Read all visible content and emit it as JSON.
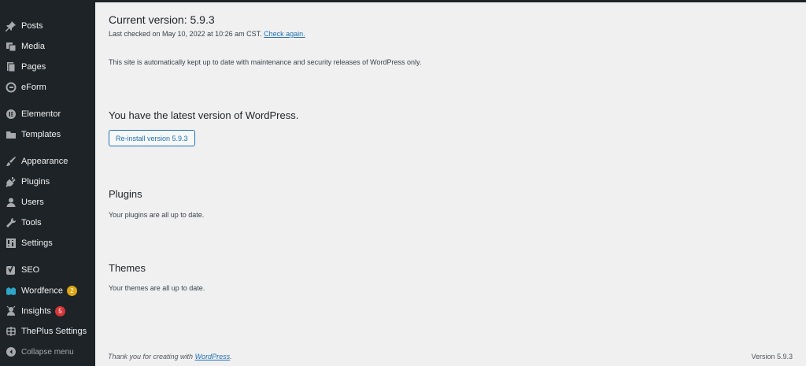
{
  "sidebar": {
    "items": [
      {
        "label": "Posts",
        "icon": "pin-icon"
      },
      {
        "label": "Media",
        "icon": "media-icon"
      },
      {
        "label": "Pages",
        "icon": "pages-icon"
      },
      {
        "label": "eForm",
        "icon": "eform-icon"
      },
      {
        "label": "Elementor",
        "icon": "elementor-icon"
      },
      {
        "label": "Templates",
        "icon": "folder-icon"
      },
      {
        "label": "Appearance",
        "icon": "brush-icon"
      },
      {
        "label": "Plugins",
        "icon": "plug-icon"
      },
      {
        "label": "Users",
        "icon": "user-icon"
      },
      {
        "label": "Tools",
        "icon": "wrench-icon"
      },
      {
        "label": "Settings",
        "icon": "settings-icon"
      },
      {
        "label": "SEO",
        "icon": "yoast-icon"
      },
      {
        "label": "Wordfence",
        "icon": "wordfence-icon",
        "badge": "2"
      },
      {
        "label": "Insights",
        "icon": "insights-icon",
        "badge": "5"
      },
      {
        "label": "ThePlus Settings",
        "icon": "theplus-icon"
      }
    ],
    "collapse_label": "Collapse menu"
  },
  "updates": {
    "current_version_title": "Current version: 5.9.3",
    "last_checked": "Last checked on May 10, 2022 at 10:26 am CST.",
    "check_again": "Check again.",
    "auto_update_note": "This site is automatically kept up to date with maintenance and security releases of WordPress only.",
    "latest_title": "You have the latest version of WordPress.",
    "reinstall_button": "Re-install version 5.9.3"
  },
  "plugins": {
    "title": "Plugins",
    "note": "Your plugins are all up to date."
  },
  "themes": {
    "title": "Themes",
    "note": "Your themes are all up to date."
  },
  "footer": {
    "thanks_prefix": "Thank you for creating with ",
    "wordpress_link": "WordPress",
    "thanks_suffix": ".",
    "version": "Version 5.9.3"
  },
  "colors": {
    "sidebar_bg": "#1d2327",
    "content_bg": "#f0f0f1",
    "link": "#2271b1",
    "badge_yellow": "#dba617",
    "badge_red": "#d63638"
  }
}
